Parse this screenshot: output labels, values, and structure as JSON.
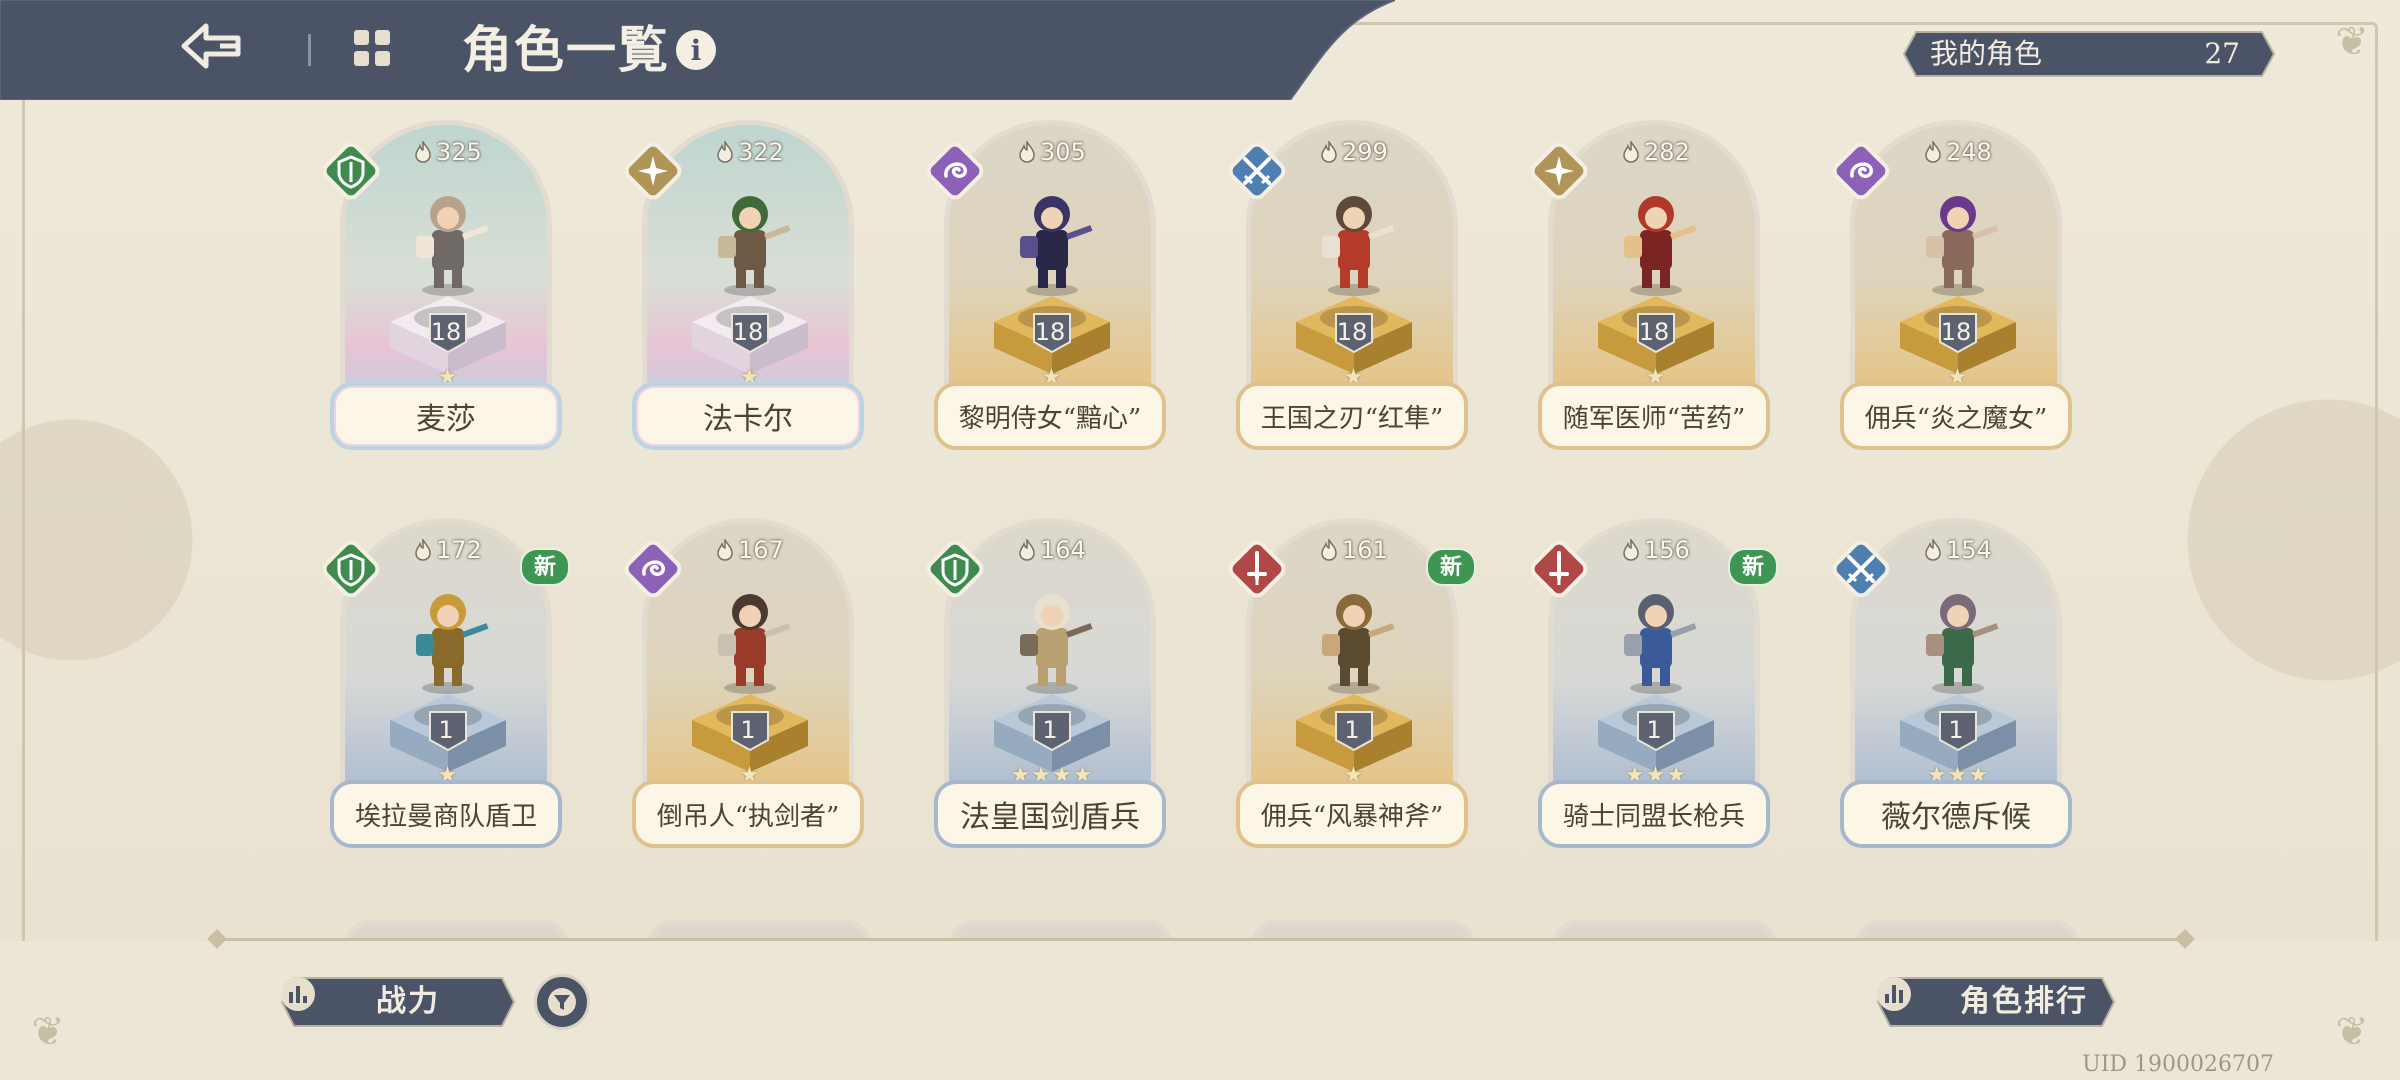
{
  "header": {
    "title": "角色一覧",
    "info_icon": "i"
  },
  "my_characters": {
    "label": "我的角色",
    "count": "27"
  },
  "cards": [
    {
      "name": "麦莎",
      "power": "325",
      "level": "18",
      "stars": "★",
      "class": "shield",
      "class_color": "#3f8b4e",
      "frame": "rainbow",
      "new": false
    },
    {
      "name": "法卡尔",
      "power": "322",
      "level": "18",
      "stars": "★",
      "class": "compass",
      "class_color": "#b09458",
      "frame": "rainbow",
      "new": false
    },
    {
      "name": "黎明侍女“黯心”",
      "power": "305",
      "level": "18",
      "stars": "★",
      "class": "swirl",
      "class_color": "#8c62b8",
      "frame": "gold",
      "new": false
    },
    {
      "name": "王国之刃“红隼”",
      "power": "299",
      "level": "18",
      "stars": "★",
      "class": "crossed-swords",
      "class_color": "#4f7eb0",
      "frame": "gold",
      "new": false
    },
    {
      "name": "随军医师“苦药”",
      "power": "282",
      "level": "18",
      "stars": "★",
      "class": "compass",
      "class_color": "#b09458",
      "frame": "gold",
      "new": false
    },
    {
      "name": "佣兵“炎之魔女”",
      "power": "248",
      "level": "18",
      "stars": "★",
      "class": "swirl",
      "class_color": "#8c62b8",
      "frame": "gold",
      "new": false
    },
    {
      "name": "埃拉曼商队盾卫",
      "power": "172",
      "level": "1",
      "stars": "★",
      "class": "shield",
      "class_color": "#3f8b4e",
      "frame": "blue",
      "new": true,
      "new_label": "新"
    },
    {
      "name": "倒吊人“执剑者”",
      "power": "167",
      "level": "1",
      "stars": "★",
      "class": "swirl",
      "class_color": "#8c62b8",
      "frame": "gold",
      "new": false
    },
    {
      "name": "法皇国剑盾兵",
      "power": "164",
      "level": "1",
      "stars": "★★★★",
      "class": "shield",
      "class_color": "#3f8b4e",
      "frame": "blue",
      "new": false
    },
    {
      "name": "佣兵“风暴神斧”",
      "power": "161",
      "level": "1",
      "stars": "★",
      "class": "sword",
      "class_color": "#b04848",
      "frame": "gold",
      "new": true,
      "new_label": "新"
    },
    {
      "name": "骑士同盟长枪兵",
      "power": "156",
      "level": "1",
      "stars": "★★★",
      "class": "sword",
      "class_color": "#b04848",
      "frame": "blue",
      "new": true,
      "new_label": "新"
    },
    {
      "name": "薇尔德斥候",
      "power": "154",
      "level": "1",
      "stars": "★★★",
      "class": "crossed-swords",
      "class_color": "#4f7eb0",
      "frame": "blue",
      "new": false
    }
  ],
  "bottom": {
    "sort_label": "战力",
    "rank_label": "角色排行",
    "uid": "UID 1900026707"
  },
  "colors": {
    "header_bg": "#4b5367",
    "accent_text": "#f4efe2",
    "background": "#ece6d6"
  },
  "icons": [
    "back-arrow-icon",
    "grid-menu-icon",
    "info-icon",
    "flame-icon",
    "bar-chart-icon",
    "filter-funnel-icon"
  ]
}
